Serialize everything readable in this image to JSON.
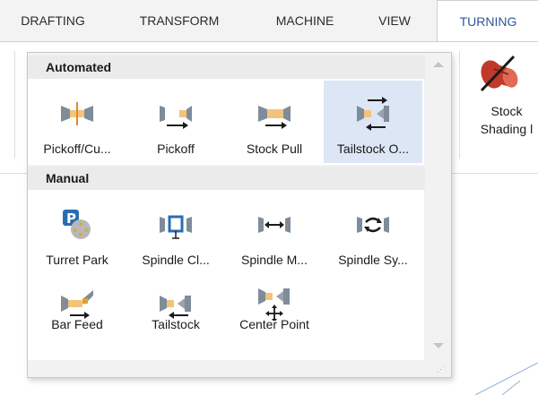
{
  "ribbon": {
    "tabs": [
      {
        "label": "DRAFTING",
        "active": false
      },
      {
        "label": "TRANSFORM",
        "active": false
      },
      {
        "label": "MACHINE",
        "active": false
      },
      {
        "label": "VIEW",
        "active": false
      },
      {
        "label": "TURNING",
        "active": true
      }
    ],
    "stock_shading": {
      "line1": "Stock",
      "line2": "Shading l"
    }
  },
  "gallery": {
    "automated": {
      "header": "Automated",
      "items": [
        {
          "label": "Pickoff/Cu...",
          "icon": "pickoff-cutoff-icon"
        },
        {
          "label": "Pickoff",
          "icon": "pickoff-icon"
        },
        {
          "label": "Stock Pull",
          "icon": "stock-pull-icon"
        },
        {
          "label": "Tailstock O...",
          "icon": "tailstock-operation-icon",
          "highlighted": true
        }
      ]
    },
    "manual": {
      "header": "Manual",
      "items": [
        {
          "label": "Turret Park",
          "icon": "turret-park-icon"
        },
        {
          "label": "Spindle Cl...",
          "icon": "spindle-clamp-icon"
        },
        {
          "label": "Spindle M...",
          "icon": "spindle-move-icon"
        },
        {
          "label": "Spindle Sy...",
          "icon": "spindle-sync-icon"
        },
        {
          "label": "Bar Feed",
          "icon": "bar-feed-icon"
        },
        {
          "label": "Tailstock",
          "icon": "tailstock-icon"
        },
        {
          "label": "Center Point",
          "icon": "center-point-icon"
        }
      ]
    }
  },
  "colors": {
    "chuck": "#7f8c99",
    "stock": "#f2c47a",
    "accent_blue": "#2b5797",
    "highlight": "#dce6f4",
    "shading_red": "#c0392b"
  }
}
